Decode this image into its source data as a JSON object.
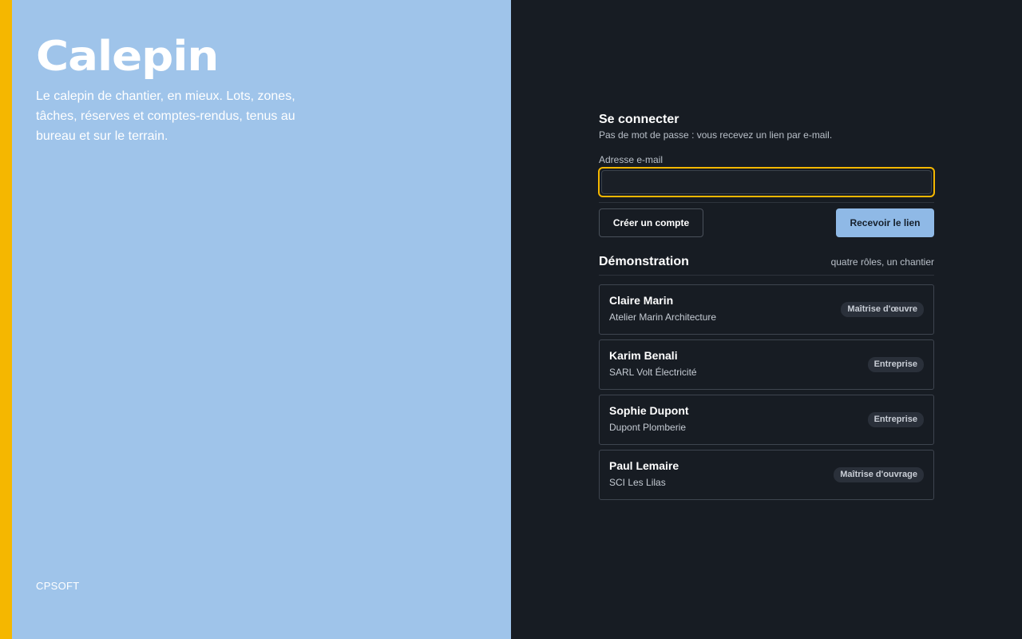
{
  "brand": {
    "title": "Calepin",
    "tagline": "Le calepin de chantier, en mieux. Lots, zones, tâches, réserves et comptes-rendus, tenus au bureau et sur le terrain.",
    "footer": "CPSOFT",
    "accent_color": "#f5b700",
    "panel_color": "#9fc4ea"
  },
  "login": {
    "heading": "Se connecter",
    "subtitle": "Pas de mot de passe : vous recevez un lien par e-mail.",
    "email_label": "Adresse e-mail",
    "email_value": "",
    "create_account_label": "Créer un compte",
    "send_link_label": "Recevoir le lien"
  },
  "demo": {
    "title": "Démonstration",
    "hint": "quatre rôles, un chantier",
    "accounts": [
      {
        "name": "Claire Marin",
        "company": "Atelier Marin Architecture",
        "role": "Maîtrise d'œuvre"
      },
      {
        "name": "Karim Benali",
        "company": "SARL Volt Électricité",
        "role": "Entreprise"
      },
      {
        "name": "Sophie Dupont",
        "company": "Dupont Plomberie",
        "role": "Entreprise"
      },
      {
        "name": "Paul Lemaire",
        "company": "SCI Les Lilas",
        "role": "Maîtrise d'ouvrage"
      }
    ]
  }
}
